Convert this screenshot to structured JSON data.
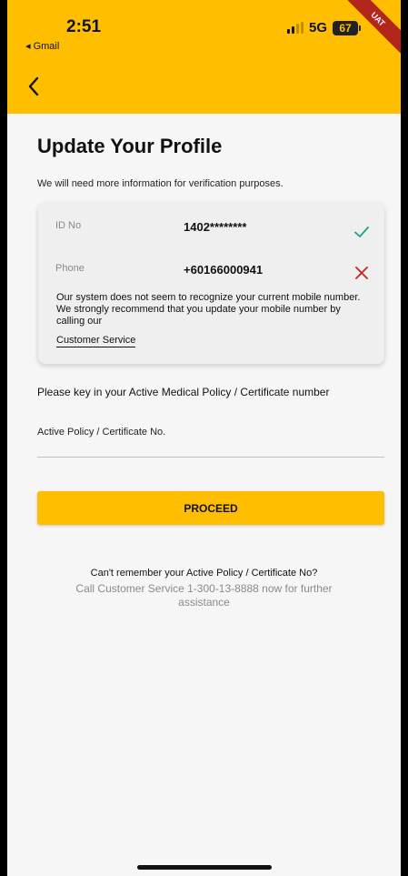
{
  "status_bar": {
    "time": "2:51",
    "back_app": "◂ Gmail",
    "network": "5G",
    "battery": "67"
  },
  "env_ribbon": "UAT",
  "header": {
    "back_icon": "chevron-left-icon"
  },
  "page": {
    "title": "Update Your Profile",
    "subtitle": "We will need more information for verification purposes."
  },
  "verification_card": {
    "id_label": "ID No",
    "id_value": "1402********",
    "id_status": "verified",
    "phone_label": "Phone",
    "phone_value": "+60166000941",
    "phone_status": "not-recognized",
    "message": "Our system does not seem to recognize your current mobile number. We strongly recommend that you update your mobile number by calling our",
    "link": "Customer Service"
  },
  "form": {
    "prompt": "Please key in your Active Medical Policy / Certificate number",
    "field_label": "Active Policy / Certificate No.",
    "field_value": "",
    "submit_label": "PROCEED"
  },
  "help": {
    "line1": "Can't remember your Active Policy / Certificate No?",
    "line2": "Call Customer Service 1-300-13-8888 now for further assistance"
  },
  "colors": {
    "brand": "#ffbf00",
    "success": "#1aa38a",
    "error": "#c62828",
    "background": "#f6f6f6"
  }
}
